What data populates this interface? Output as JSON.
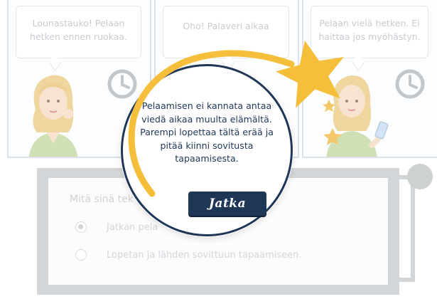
{
  "scenes": [
    {
      "speech": "Lounastauko! Pelaan hetken ennen ruokaa.",
      "icon": "clock-icon"
    },
    {
      "speech": "Oho! Palaveri alkaa",
      "icon": "clock-icon"
    },
    {
      "speech": "Pelaan vielä hetken. Ei haittaa jos myöhästyn.",
      "icon": "clock-icon"
    }
  ],
  "question": {
    "text": "Mitä sinä tek",
    "options": [
      {
        "label": "Jatkan pela",
        "selected": true
      },
      {
        "label": "Lopetan  ja lähden sovittuun tapaamiseen.",
        "selected": false
      }
    ]
  },
  "modal": {
    "message": "Pelaamisen ei kannata antaa viedä aikaa muulta elämältä. Parempi lopettaa tältä erää ja pitää kiinni sovitusta tapaamisesta.",
    "button_label": "Jatka"
  },
  "colors": {
    "navy": "#1e3657",
    "star_yellow": "#f5bf3c",
    "machine_gray": "#bcc0c3",
    "panel_border": "#c6d2de"
  }
}
